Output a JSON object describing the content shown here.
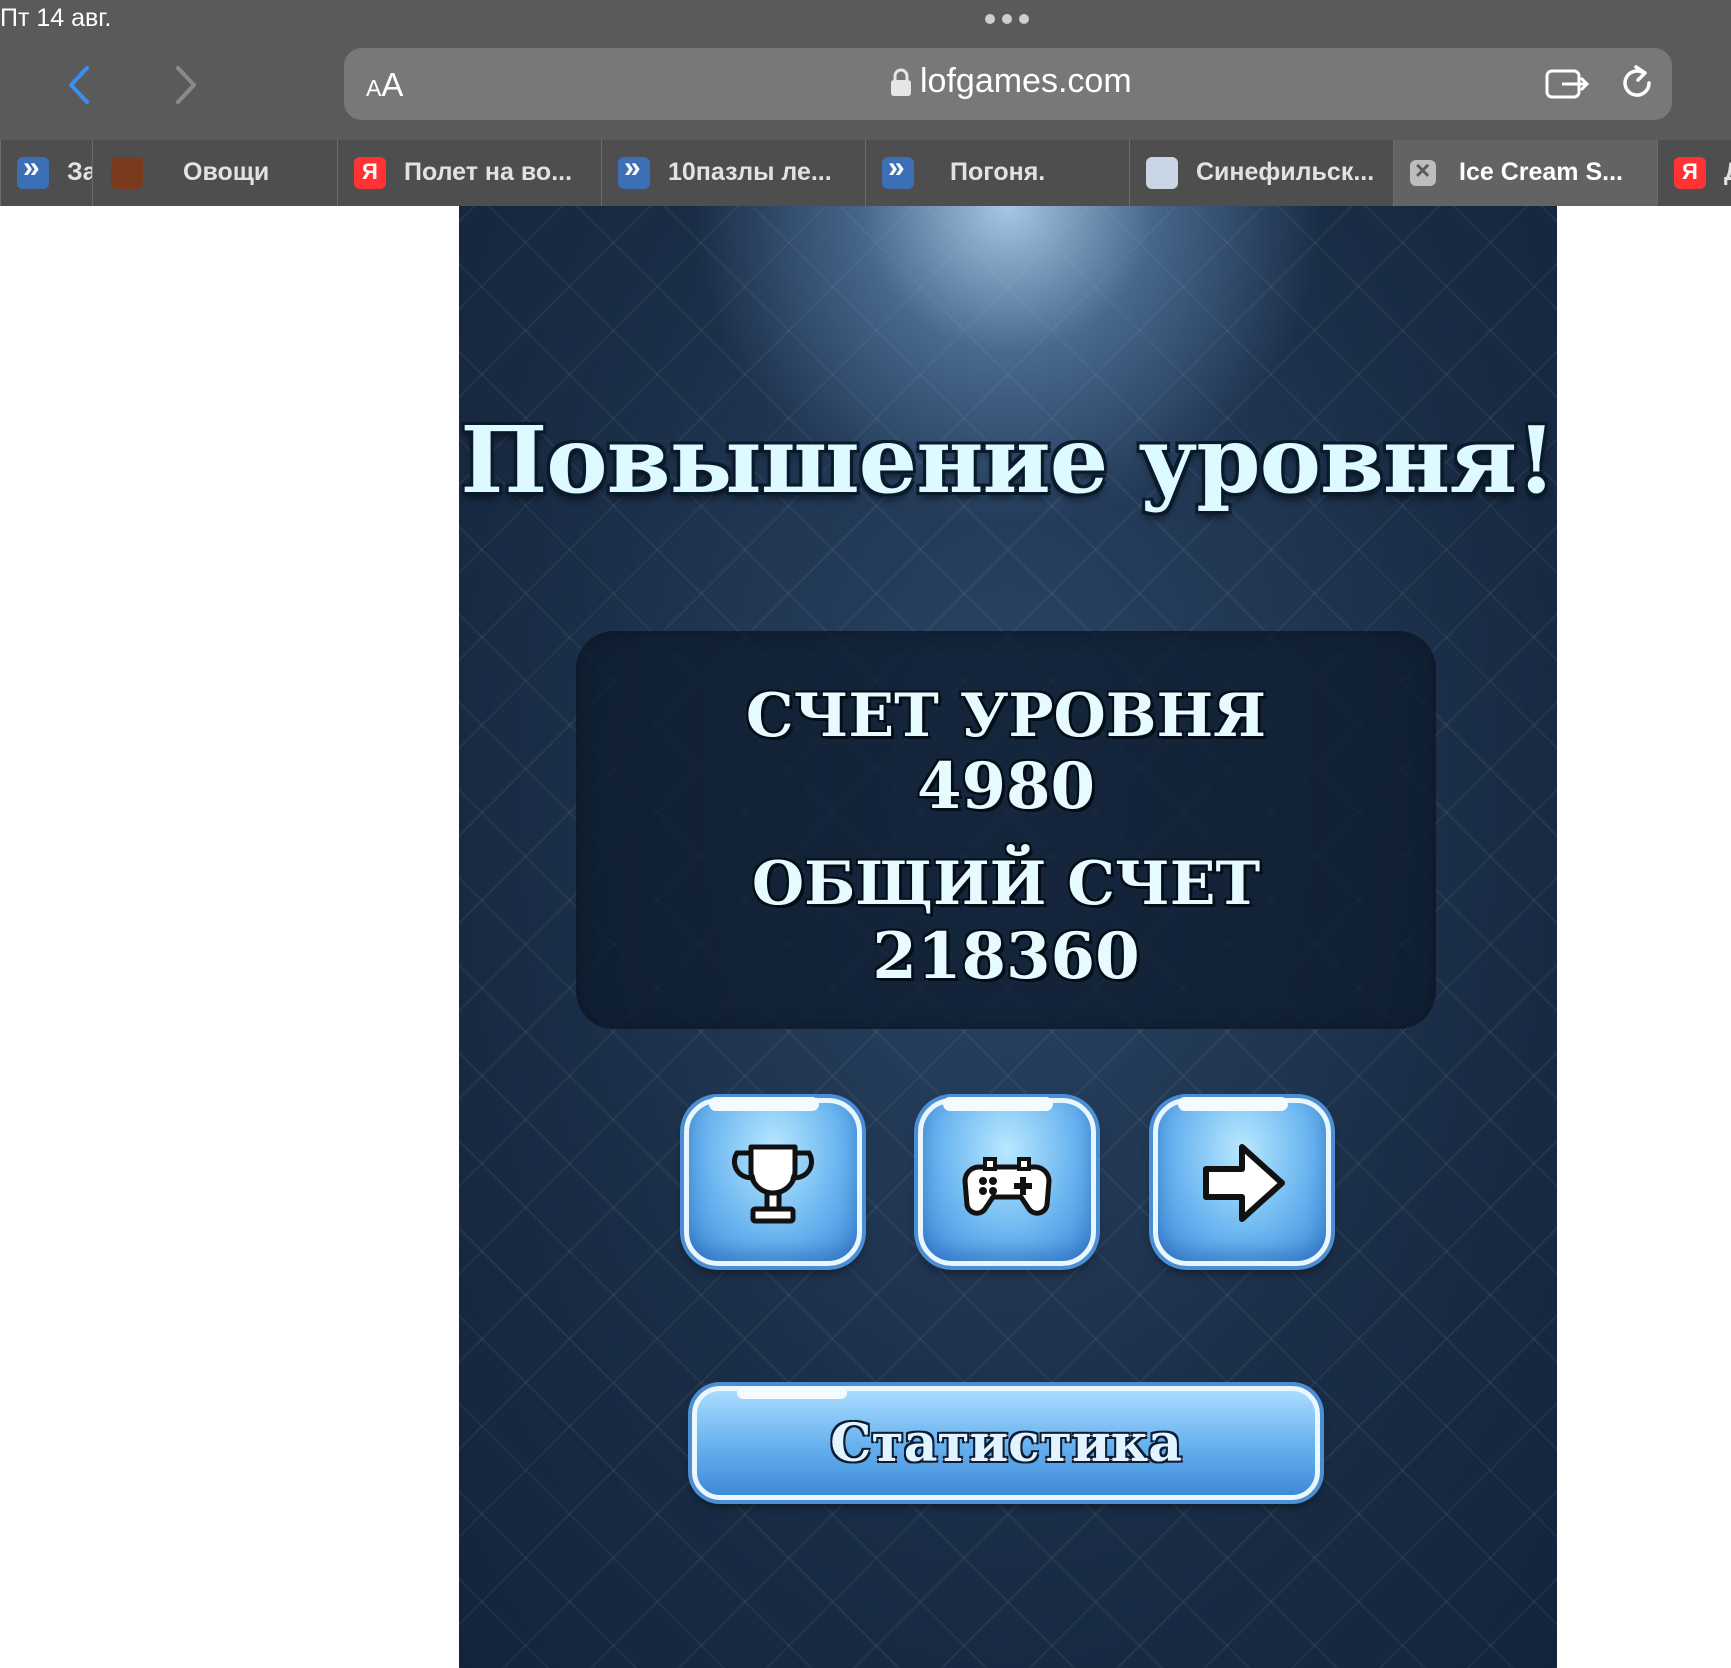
{
  "status_bar": {
    "time": "Пт 14 авг."
  },
  "browser": {
    "url": "lofgames.com",
    "text_size_label": "AA",
    "tabs": [
      {
        "label": "За",
        "icon": "lofgames-favicon"
      },
      {
        "label": "Овощи",
        "icon": "vegetables-favicon"
      },
      {
        "label": "Полет на во...",
        "icon": "yandex-favicon"
      },
      {
        "label": "10пазлы ле...",
        "icon": "lofgames-favicon"
      },
      {
        "label": "Погоня.",
        "icon": "lofgames-favicon"
      },
      {
        "label": "Синефильск...",
        "icon": "cinema-favicon"
      },
      {
        "label": "Ice Cream S...",
        "icon": "close-icon",
        "active": true
      },
      {
        "label": "Д",
        "icon": "yandex-favicon"
      }
    ]
  },
  "game": {
    "title": "Повышение уровня!",
    "level_score_label": "СЧЕТ УРОВНЯ",
    "level_score_value": "4980",
    "total_score_label": "ОБЩИЙ СЧЕТ",
    "total_score_value": "218360",
    "buttons": [
      "trophy-icon",
      "gamepad-icon",
      "arrow-right-icon"
    ],
    "stats_button_label": "Статистика"
  },
  "colors": {
    "chrome_bg": "#5a5a5a",
    "game_bg": "#1a2d46",
    "button_blue": "#6ab3ef",
    "title_text": "#dcfaff"
  }
}
